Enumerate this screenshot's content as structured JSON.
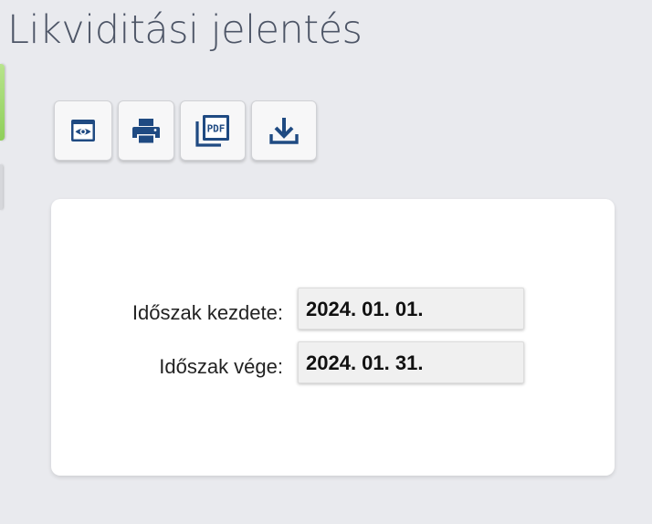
{
  "page": {
    "title": "Likviditási jelentés"
  },
  "toolbar": {
    "buttons": [
      {
        "name": "preview",
        "icon": "eye-icon"
      },
      {
        "name": "print",
        "icon": "printer-icon"
      },
      {
        "name": "pdf",
        "icon": "pdf-icon",
        "icon_text": "PDF"
      },
      {
        "name": "download",
        "icon": "download-icon"
      }
    ],
    "icon_color": "#1f4a82"
  },
  "form": {
    "start_label": "Időszak kezdete:",
    "start_value": "2024. 01. 01.",
    "end_label": "Időszak vége:",
    "end_value": "2024. 01. 31."
  },
  "colors": {
    "background": "#e9eaee",
    "title": "#4d5566",
    "accent_tab": "#9ad566"
  }
}
